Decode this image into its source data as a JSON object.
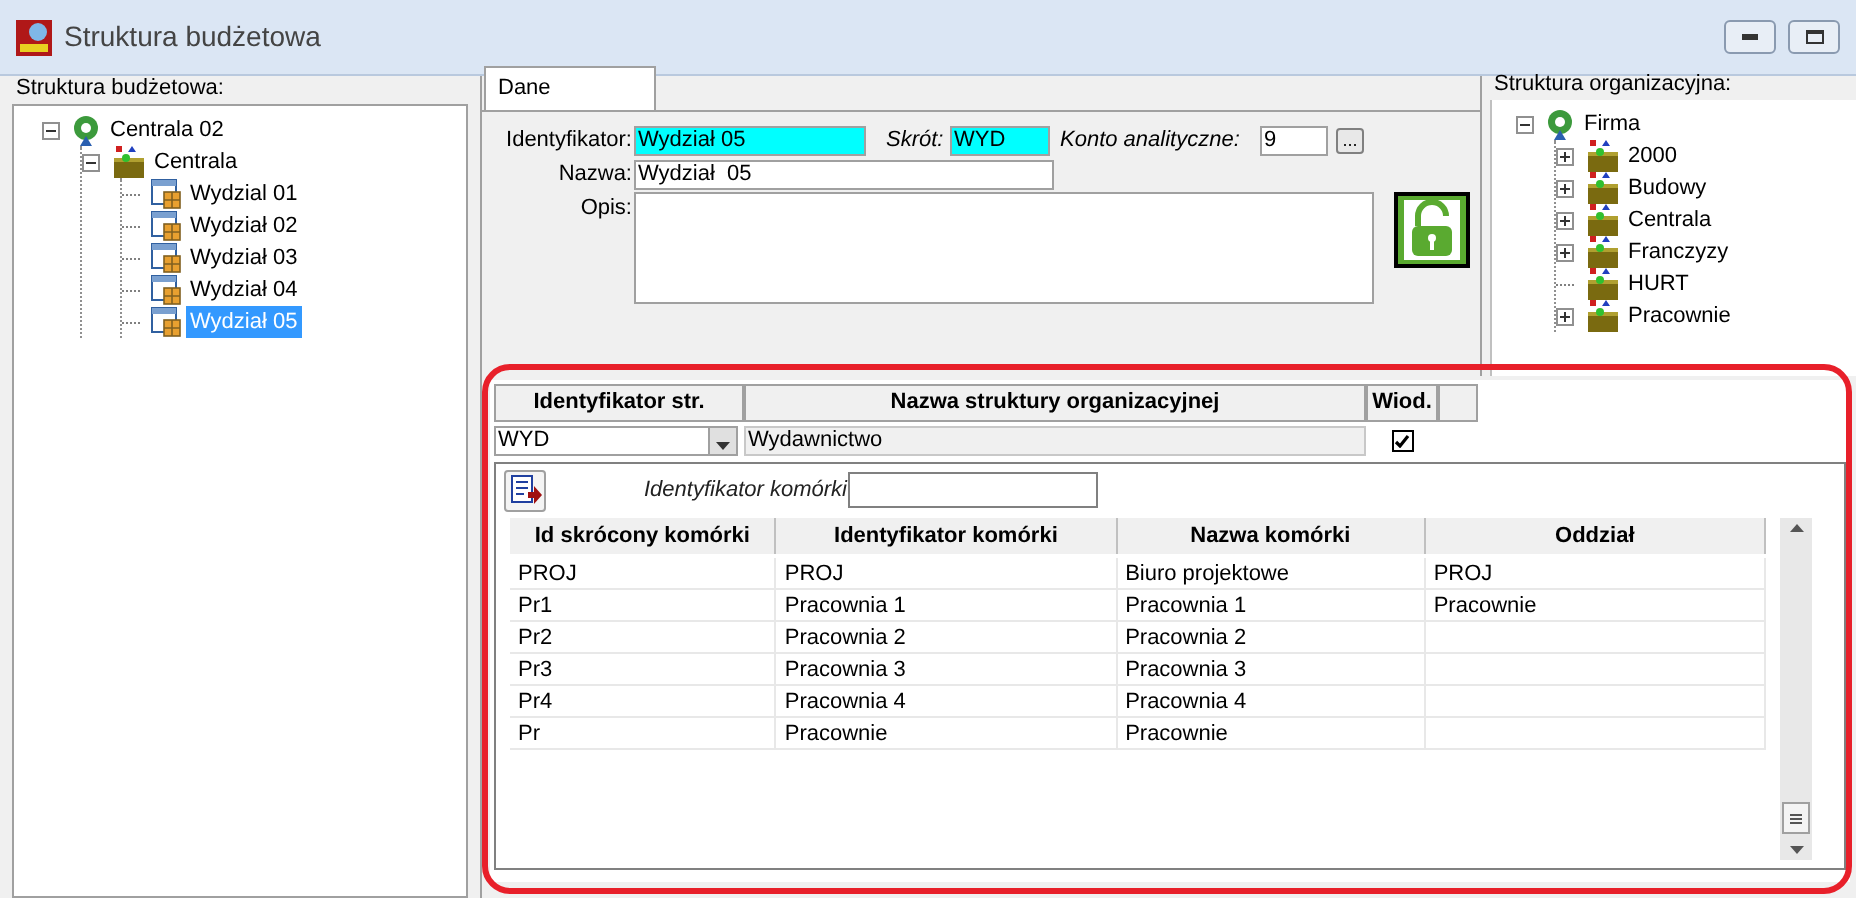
{
  "window": {
    "title": "Struktura budżetowa"
  },
  "budget_panel": {
    "label": "Struktura budżetowa:",
    "tree": [
      {
        "label": "Centrala 02",
        "kind": "company",
        "expanded": true,
        "selected": false,
        "children": [
          {
            "label": "Centrala",
            "kind": "unit",
            "expanded": true,
            "selected": false,
            "children": [
              {
                "label": "Wydzial 01",
                "kind": "department",
                "selected": false
              },
              {
                "label": "Wydział 02",
                "kind": "department",
                "selected": false
              },
              {
                "label": "Wydział 03",
                "kind": "department",
                "selected": false
              },
              {
                "label": "Wydział 04",
                "kind": "department",
                "selected": false
              },
              {
                "label": "Wydział 05",
                "kind": "department",
                "selected": true
              }
            ]
          }
        ]
      }
    ]
  },
  "tabs": [
    {
      "label": "Dane",
      "selected": true
    }
  ],
  "form": {
    "identifier": {
      "label": "Identyfikator:",
      "value": "Wydział 05",
      "highlighted": true,
      "italic": false
    },
    "short": {
      "label": "Skrót:",
      "value": "WYD",
      "highlighted": true,
      "italic": true
    },
    "account": {
      "label": "Konto analityczne:",
      "value": "9",
      "highlighted": false,
      "italic": true,
      "button": "..."
    },
    "name": {
      "label": "Nazwa:",
      "value": "Wydział  05",
      "highlighted": false,
      "italic": false
    },
    "description": {
      "label": "Opis:"
    }
  },
  "org_panel": {
    "label": "Struktura organizacyjna:",
    "tree": [
      {
        "label": "Firma",
        "kind": "company",
        "expanded": true,
        "selected": false,
        "children": [
          {
            "label": "2000",
            "kind": "unit",
            "expanded": false,
            "selected": false
          },
          {
            "label": "Budowy",
            "kind": "unit",
            "expanded": false,
            "selected": false
          },
          {
            "label": "Centrala",
            "kind": "unit",
            "expanded": false,
            "selected": false
          },
          {
            "label": "Franczyzy",
            "kind": "unit",
            "expanded": false,
            "selected": false
          },
          {
            "label": "HURT",
            "kind": "unit",
            "selected": false
          },
          {
            "label": "Pracownie",
            "kind": "unit",
            "expanded": false,
            "selected": false
          }
        ]
      }
    ]
  },
  "structure_table": {
    "columns": [
      "Identyfikator str.",
      "Nazwa struktury organizacyjnej",
      "Wiod."
    ],
    "rows": [
      {
        "id": "WYD",
        "name": "Wydawnictwo",
        "leading": true
      }
    ]
  },
  "cell_filter": {
    "label": "Identyfikator komórki"
  },
  "cells_table": {
    "columns": [
      "Id skrócony komórki",
      "Identyfikator komórki",
      "Nazwa komórki",
      "Oddział"
    ],
    "rows": [
      [
        "PROJ",
        "PROJ",
        "Biuro projektowe",
        "PROJ"
      ],
      [
        "Pr1",
        "Pracownia 1",
        "Pracownia 1",
        "Pracownie"
      ],
      [
        "Pr2",
        "Pracownia 2",
        "Pracownia 2",
        ""
      ],
      [
        "Pr3",
        "Pracownia 3",
        "Pracownia 3",
        ""
      ],
      [
        "Pr4",
        "Pracownia 4",
        "Pracownia 4",
        ""
      ],
      [
        "Pr",
        "Pracownie",
        "Pracownie",
        ""
      ]
    ]
  }
}
